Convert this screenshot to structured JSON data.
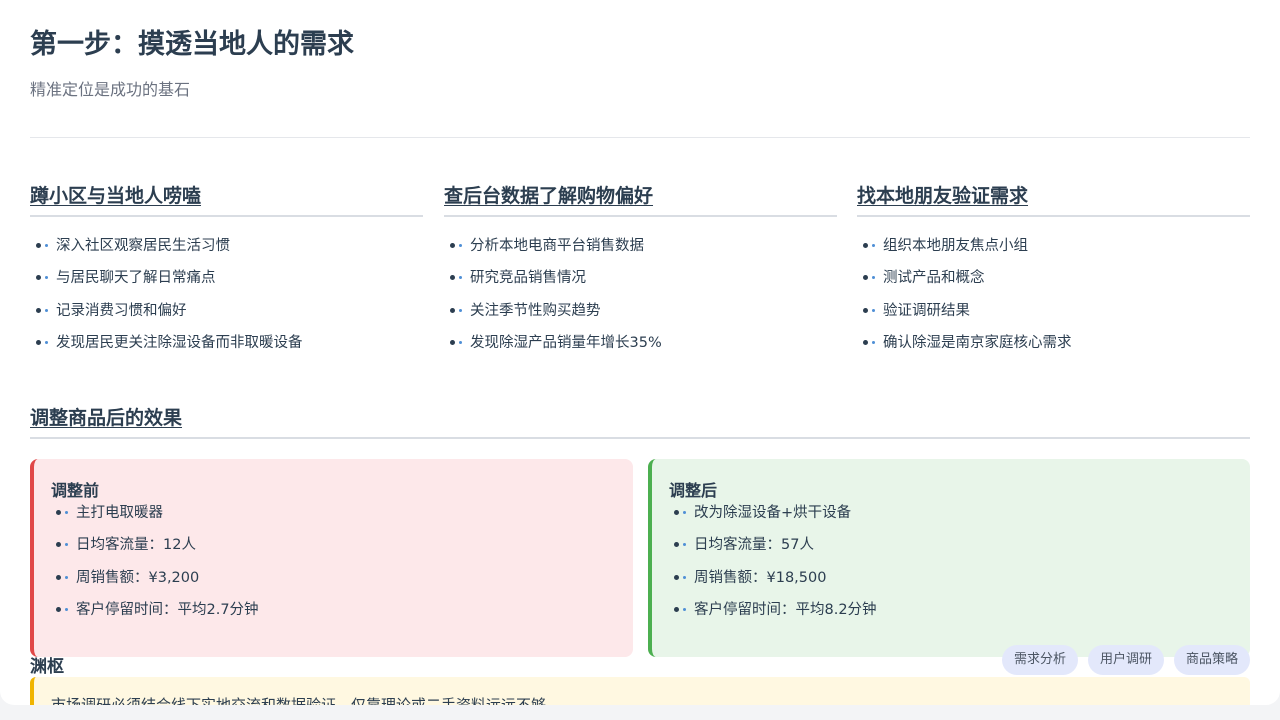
{
  "header": {
    "title": "第一步：摸透当地人的需求",
    "subtitle": "精准定位是成功的基石"
  },
  "columns": [
    {
      "heading": "蹲小区与当地人唠嗑",
      "items": [
        "深入社区观察居民生活习惯",
        "与居民聊天了解日常痛点",
        "记录消费习惯和偏好",
        "发现居民更关注除湿设备而非取暖设备"
      ]
    },
    {
      "heading": "查后台数据了解购物偏好",
      "items": [
        "分析本地电商平台销售数据",
        "研究竞品销售情况",
        "关注季节性购买趋势",
        "发现除湿产品销量年增长35%"
      ]
    },
    {
      "heading": "找本地朋友验证需求",
      "items": [
        "组织本地朋友焦点小组",
        "测试产品和概念",
        "验证调研结果",
        "确认除湿是南京家庭核心需求"
      ]
    }
  ],
  "effect": {
    "heading": "调整商品后的效果",
    "before": {
      "title": "调整前",
      "items": [
        "主打电取暖器",
        "日均客流量：12人",
        "周销售额：¥3,200",
        "客户停留时间：平均2.7分钟"
      ]
    },
    "after": {
      "title": "调整后",
      "items": [
        "改为除湿设备+烘干设备",
        "日均客流量：57人",
        "周销售额：¥18,500",
        "客户停留时间：平均8.2分钟"
      ]
    }
  },
  "tags": [
    "需求分析",
    "用户调研",
    "商品策略"
  ],
  "author": "渊枢",
  "note": "市场调研必须结合线下实地交流和数据验证，仅靠理论或二手资料远远不够",
  "colors": {
    "text": "#2c3e50",
    "before_bg": "#fde8ea",
    "before_accent": "#e04848",
    "after_bg": "#e8f5e9",
    "after_accent": "#4caf50",
    "tag_bg": "#e3e8fb",
    "note_bg": "#fff8e1",
    "note_accent": "#f0b400"
  }
}
